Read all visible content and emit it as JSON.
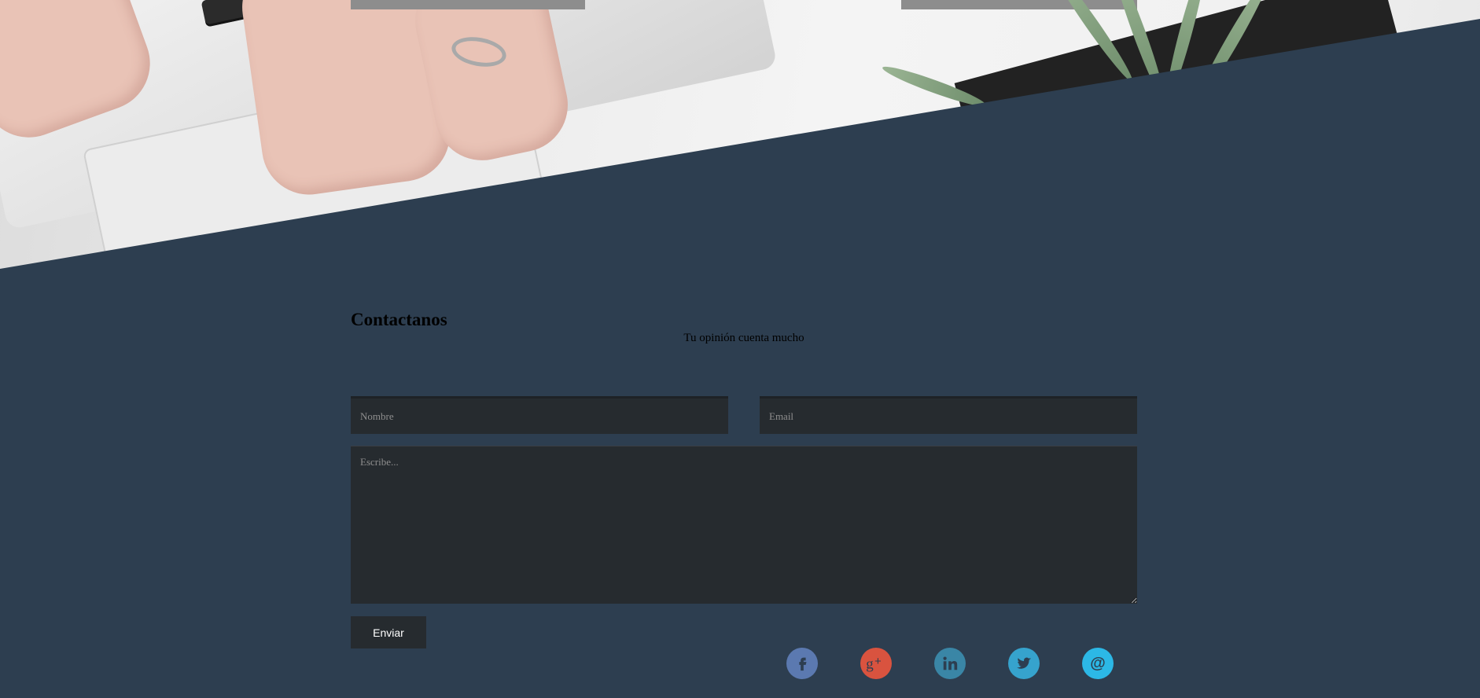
{
  "hero": {
    "image": "laptop-hands-plant-photo"
  },
  "contact": {
    "title": "Contactanos",
    "subtitle": "Tu opinión cuenta mucho",
    "name_placeholder": "Nombre",
    "email_placeholder": "Email",
    "message_placeholder": "Escribe...",
    "send_label": "Enviar"
  },
  "social": [
    {
      "name": "facebook-icon",
      "color": "#5b79b0"
    },
    {
      "name": "google-plus-icon",
      "color": "#d9533f"
    },
    {
      "name": "linkedin-icon",
      "color": "#3a86a6"
    },
    {
      "name": "twitter-icon",
      "color": "#36a3cd"
    },
    {
      "name": "email-icon",
      "color": "#2cb8e6"
    }
  ],
  "colors": {
    "background": "#2d3e50",
    "field": "#262b2f",
    "button": "#262b2f"
  }
}
